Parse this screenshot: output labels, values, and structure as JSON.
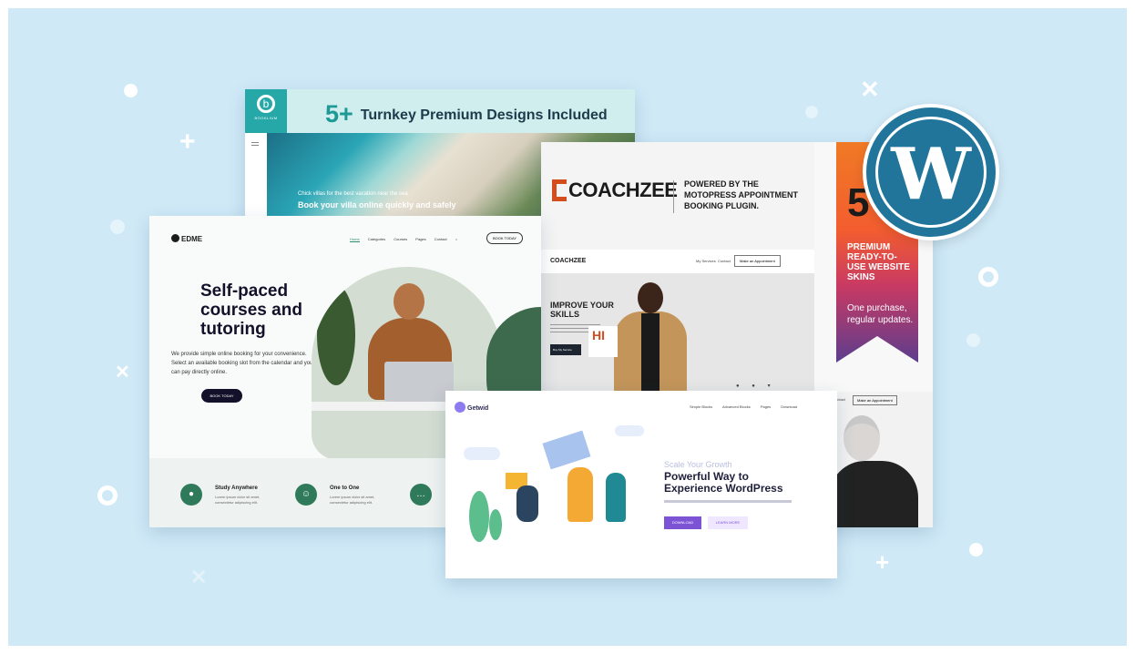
{
  "booklium": {
    "logo_text": "BOOKLIUM",
    "headline_number": "5+",
    "headline": "Turnkey Premium Designs Included",
    "hero_small": "Chick villas for the best vacation near the sea",
    "hero_title": "Book your villa online quickly and safely"
  },
  "coachzee": {
    "logo": "COACHZEE",
    "powered_by": "POWERED BY THE MOTOPRESS APPOINTMENT BOOKING PLUGIN.",
    "mini_logo": "COACHZEE",
    "nav": [
      "My Services",
      "Contact"
    ],
    "appt_button": "Make an Appointment",
    "improve": "IMPROVE YOUR SKILLS",
    "hi_badge": "HI",
    "cta": "Buy My Service"
  },
  "ribbon": {
    "number": "5",
    "premium": "PREMIUM READY-TO-USE WEBSITE SKINS",
    "updates": "One purchase, regular updates."
  },
  "woman_panel": {
    "nav": "Contact",
    "button": "Make an Appointment"
  },
  "wordpress": {
    "glyph": "W",
    "color": "#21759b"
  },
  "edme": {
    "logo": "EDME",
    "nav": [
      "Home",
      "Categories",
      "Courses",
      "Pages",
      "Contact"
    ],
    "book_button": "BOOK TODAY",
    "headline": "Self-paced courses and tutoring",
    "description": "We provide simple online booking for your convenience. Select an available booking slot from the calendar and you can pay directly online.",
    "cta": "BOOK TODAY",
    "features": [
      {
        "icon": "location-pin-icon",
        "glyph": "●",
        "title": "Study Anywhere",
        "text": "Lorem ipsum dolor sit amet, consectetur adipiscing elit."
      },
      {
        "icon": "users-icon",
        "glyph": "☺",
        "title": "One to One",
        "text": "Lorem ipsum dolor sit amet, consectetur adipiscing elit."
      },
      {
        "icon": "chat-icon",
        "glyph": "…",
        "title": "",
        "text": ""
      }
    ]
  },
  "getwid": {
    "logo": "Getwid",
    "nav": [
      "Simple Blocks",
      "Advanced Blocks",
      "Pages",
      "Download"
    ],
    "kicker": "Scale Your Growth",
    "headline": "Powerful Way to Experience WordPress",
    "primary_button": "DOWNLOAD",
    "secondary_button": "LEARN MORE"
  },
  "colors": {
    "background": "#cfe9f7",
    "booklium_teal": "#27a8a8",
    "coachzee_orange": "#d44d1c",
    "edme_green": "#2f7a5a",
    "getwid_purple": "#7d53d6"
  }
}
